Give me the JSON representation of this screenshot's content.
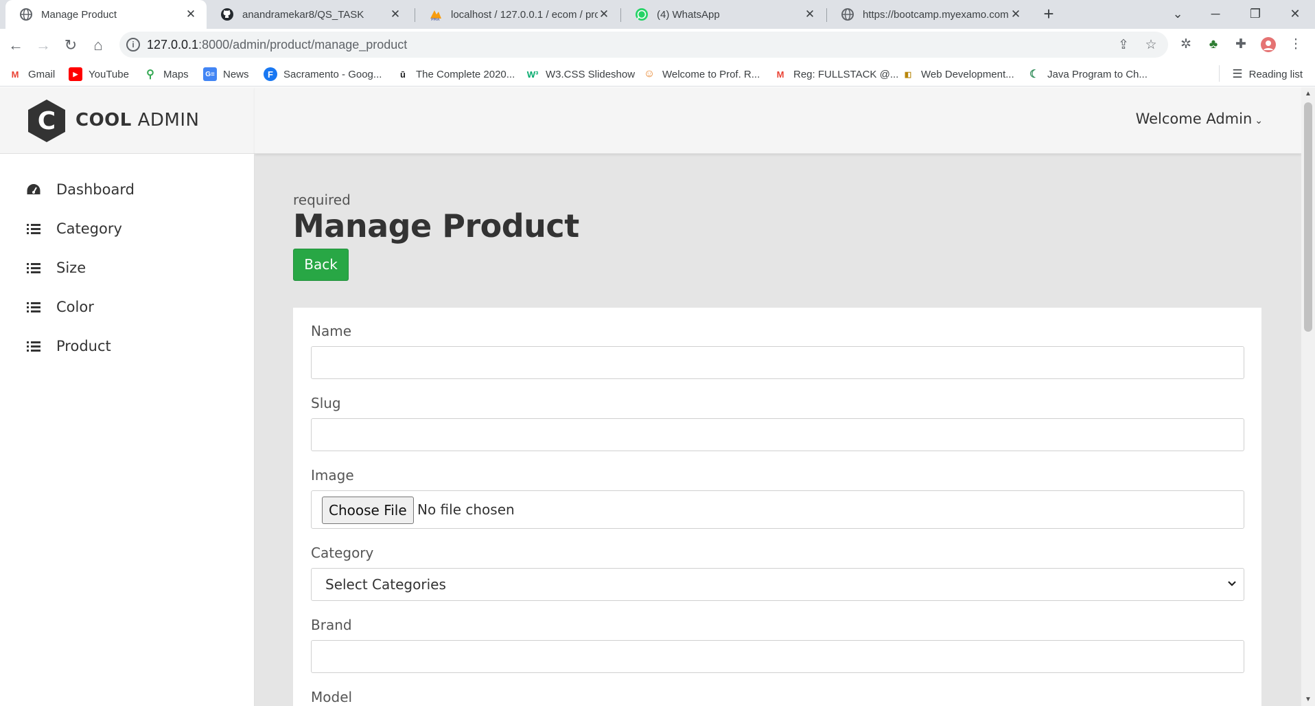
{
  "browser": {
    "tabs": [
      {
        "title": "Manage Product",
        "active": true,
        "icon": "globe-icon"
      },
      {
        "title": "anandramekar8/QS_TASK",
        "active": false,
        "icon": "github-icon"
      },
      {
        "title": "localhost / 127.0.0.1 / ecom / pro",
        "active": false,
        "icon": "phpmyadmin-icon"
      },
      {
        "title": "(4) WhatsApp",
        "active": false,
        "icon": "whatsapp-icon"
      },
      {
        "title": "https://bootcamp.myexamo.com",
        "active": false,
        "icon": "globe-icon"
      }
    ],
    "url_host": "127.0.0.1",
    "url_path": ":8000/admin/product/manage_product",
    "bookmarks": [
      {
        "label": "Gmail",
        "icon": "gmail-icon"
      },
      {
        "label": "YouTube",
        "icon": "youtube-icon"
      },
      {
        "label": "Maps",
        "icon": "maps-icon"
      },
      {
        "label": "News",
        "icon": "news-icon"
      },
      {
        "label": "Sacramento - Goog...",
        "icon": "facebook-icon"
      },
      {
        "label": "The Complete 2020...",
        "icon": "udemy-icon"
      },
      {
        "label": "W3.CSS Slideshow",
        "icon": "w3schools-icon"
      },
      {
        "label": "Welcome to Prof. R...",
        "icon": "profile-icon"
      },
      {
        "label": "Reg: FULLSTACK @...",
        "icon": "gmail-icon"
      },
      {
        "label": "Web Development...",
        "icon": "web-icon"
      },
      {
        "label": "Java Program to Ch...",
        "icon": "java-icon"
      }
    ],
    "reading_list": "Reading list"
  },
  "app": {
    "logo_bold": "COOL",
    "logo_light": "ADMIN",
    "logo_letter": "C",
    "welcome": "Welcome Admin",
    "sidebar": [
      {
        "label": "Dashboard",
        "icon": "dashboard-icon"
      },
      {
        "label": "Category",
        "icon": "list-icon"
      },
      {
        "label": "Size",
        "icon": "list-icon"
      },
      {
        "label": "Color",
        "icon": "list-icon"
      },
      {
        "label": "Product",
        "icon": "list-icon"
      }
    ]
  },
  "main": {
    "required_text": "required",
    "title": "Manage Product",
    "back_label": "Back",
    "form": {
      "name_label": "Name",
      "name_value": "",
      "slug_label": "Slug",
      "slug_value": "",
      "image_label": "Image",
      "file_button": "Choose File",
      "file_status": "No file chosen",
      "category_label": "Category",
      "category_selected": "Select Categories",
      "brand_label": "Brand",
      "brand_value": "",
      "model_label": "Model"
    }
  },
  "colors": {
    "back_button": "#28a745",
    "page_bg": "#e5e5e5",
    "chrome_bg": "#dee1e6"
  }
}
